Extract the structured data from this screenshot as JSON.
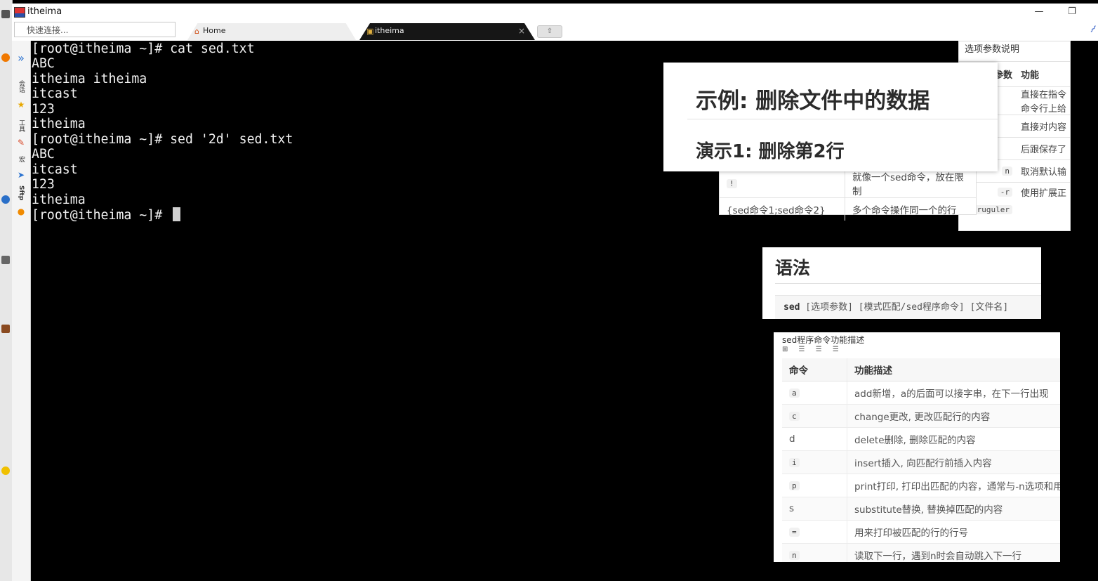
{
  "window": {
    "title": "itheima",
    "min_icon": "—",
    "max_icon": "❐",
    "quick_connect_placeholder": "快速连接...",
    "tabs": [
      {
        "label": "Home",
        "icon": "home-icon"
      },
      {
        "label": "itheima",
        "icon": "terminal-icon",
        "close": "×"
      }
    ],
    "new_tab_glyph": "⇧"
  },
  "sidebar": {
    "expand_glyph": "»",
    "labels": [
      "会话",
      "工具",
      "宏",
      "Sftp"
    ]
  },
  "terminal": {
    "lines": [
      "[root@itheima ~]# cat sed.txt",
      "ABC",
      "itheima itheima",
      "itcast",
      "123",
      "itheima",
      "[root@itheima ~]# sed '2d' sed.txt",
      "ABC",
      "itcast",
      "123",
      "itheima",
      "[root@itheima ~]# "
    ]
  },
  "options_card": {
    "caption": "选项参数说明",
    "header": [
      "参数",
      "功能"
    ],
    "rows": [
      [
        "",
        "直接在指令"
      ],
      [
        "",
        "命令行上给"
      ],
      [
        "",
        "直接对内容"
      ],
      [
        "",
        "后跟保存了"
      ],
      [
        "n",
        "取消默认输"
      ],
      [
        "-r",
        "使用扩展正"
      ],
      [
        "ruguler",
        ""
      ]
    ]
  },
  "commands_partial": {
    "rows": [
      [
        "!",
        "就像一个sed命令，放在限制"
      ],
      [
        "{sed命令1;sed命令2}",
        "多个命令操作同一个的行"
      ]
    ]
  },
  "headline": {
    "title": "示例: 删除文件中的数据",
    "subtitle": "演示1: 删除第2行"
  },
  "syntax": {
    "heading": "语法",
    "code_cmd": "sed",
    "code_rest": " [选项参数] [模式匹配/sed程序命令] [文件名]"
  },
  "sed_commands": {
    "caption": "sed程序命令功能描述",
    "toolbar": "⊞ ☰ ☰ ☰",
    "header": [
      "命令",
      "功能描述"
    ],
    "rows": [
      [
        "a",
        "add新增，a的后面可以接字串，在下一行出现"
      ],
      [
        "c",
        "change更改, 更改匹配行的内容"
      ],
      [
        "d",
        "delete删除, 删除匹配的内容"
      ],
      [
        "i",
        "insert插入, 向匹配行前插入内容"
      ],
      [
        "p",
        "print打印, 打印出匹配的内容，通常与-n选项和用"
      ],
      [
        "s",
        "substitute替换, 替换掉匹配的内容"
      ],
      [
        "=",
        "用来打印被匹配的行的行号"
      ],
      [
        "n",
        "读取下一行，遇到n时会自动跳入下一行"
      ]
    ]
  }
}
